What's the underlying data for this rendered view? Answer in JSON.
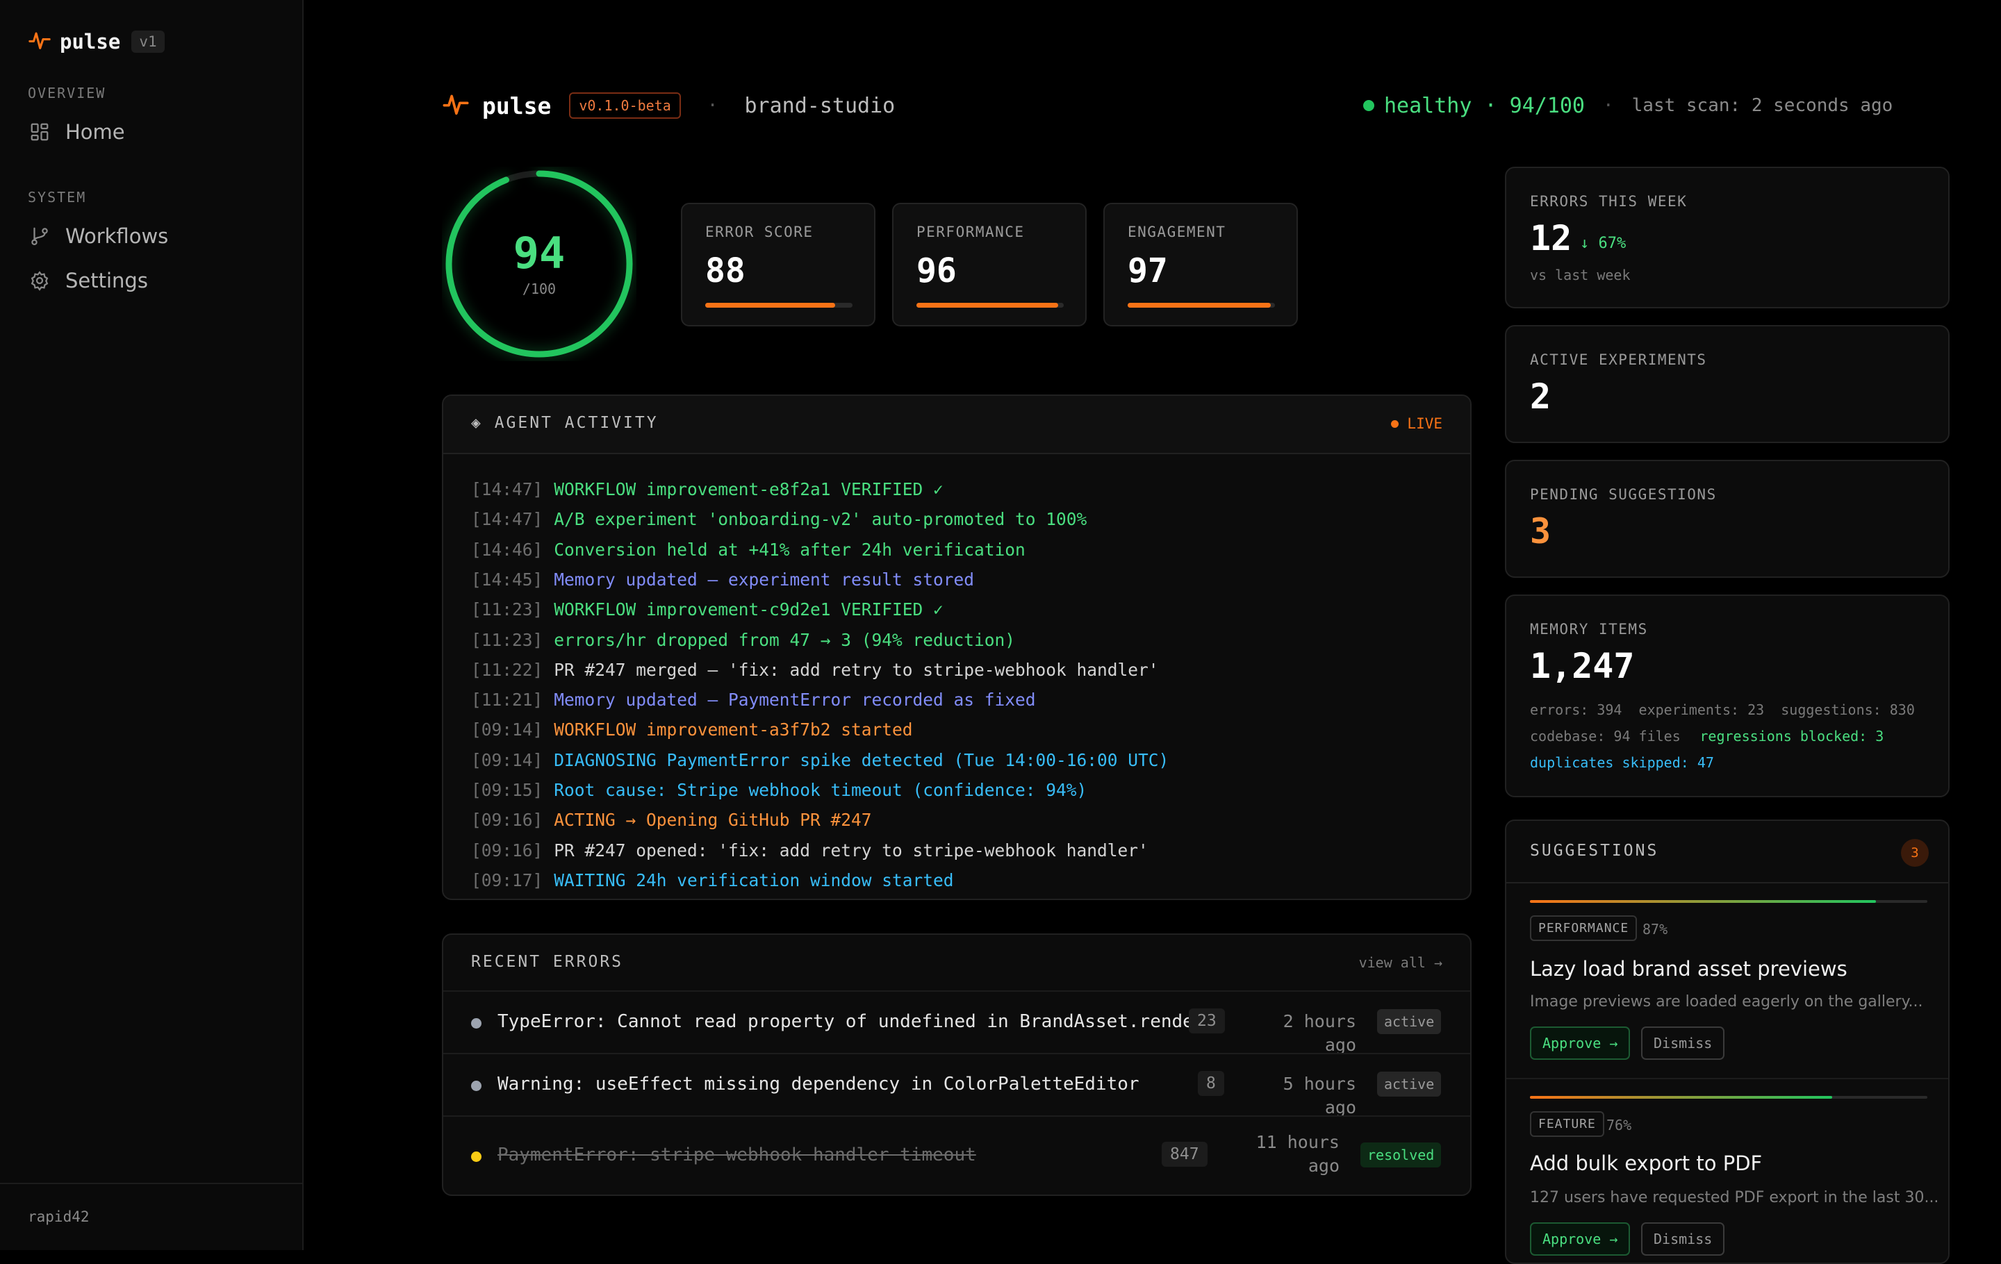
{
  "colors": {
    "accent": "#f97316",
    "healthy": "#22c55e",
    "memory": "#818cf8",
    "diagnose": "#38bdf8"
  },
  "sidebar": {
    "brand": "pulse",
    "version": "v1",
    "sections": [
      {
        "title": "OVERVIEW",
        "items": [
          {
            "label": "Home",
            "icon": "grid-icon"
          }
        ]
      },
      {
        "title": "SYSTEM",
        "items": [
          {
            "label": "Workflows",
            "icon": "git-branch-icon"
          },
          {
            "label": "Settings",
            "icon": "gear-icon"
          }
        ]
      }
    ],
    "user": "rapid42"
  },
  "header": {
    "brand": "pulse",
    "version": "v0.1.0-beta",
    "separator": "·",
    "project": "brand-studio",
    "status": "healthy · 94/100",
    "last_scan": "last scan: 2 seconds ago"
  },
  "score": {
    "value": "94",
    "max": "/100",
    "fraction": 0.94
  },
  "metrics": [
    {
      "label": "ERROR SCORE",
      "value": "88",
      "progress": 0.88
    },
    {
      "label": "PERFORMANCE",
      "value": "96",
      "progress": 0.96
    },
    {
      "label": "ENGAGEMENT",
      "value": "97",
      "progress": 0.97
    }
  ],
  "agent_activity": {
    "title": "◈ AGENT ACTIVITY",
    "live_label": "LIVE",
    "log": [
      {
        "time": "[14:47]",
        "text": "WORKFLOW improvement-e8f2a1 VERIFIED ✓",
        "color": "#4ade80"
      },
      {
        "time": "[14:47]",
        "text": "A/B experiment 'onboarding-v2' auto-promoted to 100%",
        "color": "#4ade80"
      },
      {
        "time": "[14:46]",
        "text": "Conversion held at +41% after 24h verification",
        "color": "#4ade80"
      },
      {
        "time": "[14:45]",
        "text": "Memory updated — experiment result stored",
        "color": "#818cf8"
      },
      {
        "time": "[11:23]",
        "text": "WORKFLOW improvement-c9d2e1 VERIFIED ✓",
        "color": "#4ade80"
      },
      {
        "time": "[11:23]",
        "text": "errors/hr dropped from 47 → 3 (94% reduction)",
        "color": "#4ade80"
      },
      {
        "time": "[11:22]",
        "text": "PR #247 merged — 'fix: add retry to stripe-webhook handler'",
        "color": "#d4d4d4"
      },
      {
        "time": "[11:21]",
        "text": "Memory updated — PaymentError recorded as fixed",
        "color": "#818cf8"
      },
      {
        "time": "[09:14]",
        "text": "WORKFLOW improvement-a3f7b2 started",
        "color": "#fb923c"
      },
      {
        "time": "[09:14]",
        "text": "DIAGNOSING PaymentError spike detected (Tue 14:00-16:00 UTC)",
        "color": "#38bdf8"
      },
      {
        "time": "[09:15]",
        "text": "Root cause: Stripe webhook timeout (confidence: 94%)",
        "color": "#38bdf8"
      },
      {
        "time": "[09:16]",
        "text": "ACTING → Opening GitHub PR #247",
        "color": "#fb923c"
      },
      {
        "time": "[09:16]",
        "text": "PR #247 opened: 'fix: add retry to stripe-webhook handler'",
        "color": "#d4d4d4"
      },
      {
        "time": "[09:17]",
        "text": "WAITING 24h verification window started",
        "color": "#38bdf8"
      }
    ]
  },
  "recent_errors": {
    "title": "RECENT ERRORS",
    "view_all": "view all →",
    "rows": [
      {
        "message": "TypeError: Cannot read property of undefined in BrandAsset.render()",
        "count": "23",
        "time": "2 hours ago",
        "status": "active",
        "dot": "#9ca3af"
      },
      {
        "message": "Warning: useEffect missing dependency in ColorPaletteEditor",
        "count": "8",
        "time": "5 hours ago",
        "status": "active",
        "dot": "#9ca3af"
      },
      {
        "message": "PaymentError: stripe webhook handler timeout",
        "count": "847",
        "time": "11 hours ago",
        "status": "resolved",
        "dot": "#facc15"
      }
    ]
  },
  "stats": {
    "errors_week": {
      "label": "ERRORS THIS WEEK",
      "value": "12",
      "delta": "↓ 67%",
      "sub": "vs last week"
    },
    "experiments": {
      "label": "ACTIVE EXPERIMENTS",
      "value": "2"
    },
    "pending": {
      "label": "PENDING SUGGESTIONS",
      "value": "3"
    },
    "memory": {
      "label": "MEMORY ITEMS",
      "value": "1,247",
      "line1": "errors: 394  experiments: 23  suggestions: 830",
      "line2a": "codebase: 94 files",
      "line2b": "regressions blocked: 3",
      "line3": "duplicates skipped: 47"
    }
  },
  "suggestions": {
    "title": "SUGGESTIONS",
    "count": "3",
    "items": [
      {
        "tag": "PERFORMANCE",
        "pct": "87%",
        "confidence": 0.87,
        "title": "Lazy load brand asset previews",
        "desc": "Image previews are loaded eagerly on the gallery...",
        "approve": "Approve →",
        "dismiss": "Dismiss"
      },
      {
        "tag": "FEATURE",
        "pct": "76%",
        "confidence": 0.76,
        "title": "Add bulk export to PDF",
        "desc": "127 users have requested PDF export in the last 30...",
        "approve": "Approve →",
        "dismiss": "Dismiss"
      }
    ]
  }
}
